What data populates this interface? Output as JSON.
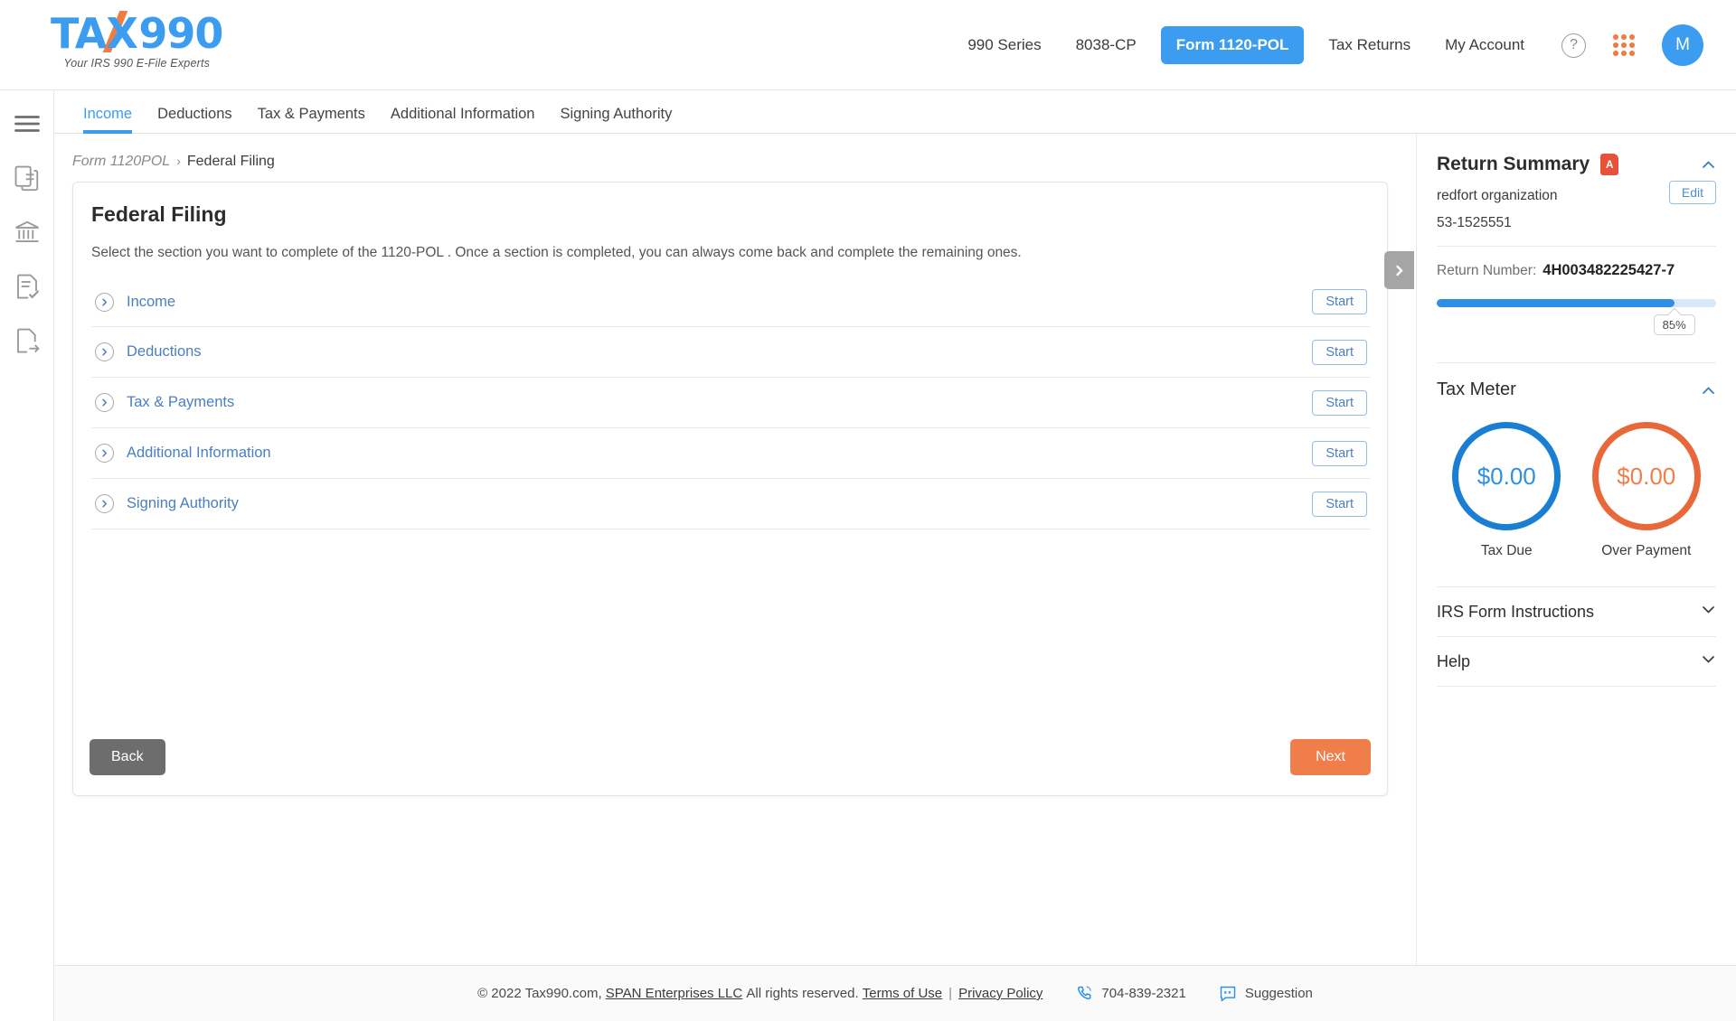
{
  "brand": {
    "logo_text": "TAX990",
    "logo_part_a": "TA",
    "logo_part_b": "990",
    "tagline": "Your IRS 990 E-File Experts",
    "accent_blue": "#3b9cf0",
    "accent_orange": "#ef7b45"
  },
  "topnav": {
    "items": [
      {
        "label": "990 Series",
        "active": false
      },
      {
        "label": "8038-CP",
        "active": false
      },
      {
        "label": "Form 1120-POL",
        "active": true
      },
      {
        "label": "Tax Returns",
        "active": false
      },
      {
        "label": "My Account",
        "active": false
      }
    ],
    "help_icon": "question-mark-icon",
    "apps_icon": "grid-apps-icon",
    "avatar_initial": "M"
  },
  "rail": {
    "items": [
      {
        "icon": "hamburger-menu-icon",
        "name": "menu-toggle"
      },
      {
        "icon": "documents-icon",
        "name": "documents"
      },
      {
        "icon": "bank-institution-icon",
        "name": "institution"
      },
      {
        "icon": "checklist-icon",
        "name": "checklist"
      },
      {
        "icon": "file-export-icon",
        "name": "export"
      }
    ]
  },
  "tabs": [
    {
      "label": "Income",
      "active": true
    },
    {
      "label": "Deductions",
      "active": false
    },
    {
      "label": "Tax & Payments",
      "active": false
    },
    {
      "label": "Additional Information",
      "active": false
    },
    {
      "label": "Signing Authority",
      "active": false
    }
  ],
  "breadcrumb": {
    "previous": "Form 1120POL",
    "separator": "›",
    "current": "Federal Filing"
  },
  "card": {
    "title": "Federal Filing",
    "description": "Select the section you want to complete of the 1120-POL . Once a section is completed, you can always come back and complete the remaining ones.",
    "sections": [
      {
        "label": "Income",
        "action": "Start"
      },
      {
        "label": "Deductions",
        "action": "Start"
      },
      {
        "label": "Tax & Payments",
        "action": "Start"
      },
      {
        "label": "Additional Information",
        "action": "Start"
      },
      {
        "label": "Signing Authority",
        "action": "Start"
      }
    ],
    "back_label": "Back",
    "next_label": "Next"
  },
  "right_panel": {
    "return_summary": {
      "title": "Return Summary",
      "pdf_icon": "pdf-file-icon",
      "organization": "redfort organization",
      "ein": "53-1525551",
      "edit_label": "Edit",
      "return_number_label": "Return Number:",
      "return_number_value": "4H003482225427-7",
      "progress_percent": 85,
      "progress_label": "85%"
    },
    "tax_meter": {
      "title": "Tax Meter",
      "meters": [
        {
          "value": "$0.00",
          "label": "Tax Due",
          "color": "#1a7fd4"
        },
        {
          "value": "$0.00",
          "label": "Over Payment",
          "color": "#e8683a"
        }
      ]
    },
    "accordions": [
      {
        "label": "IRS Form Instructions",
        "expanded": false
      },
      {
        "label": "Help",
        "expanded": false
      }
    ]
  },
  "footer": {
    "copyright": "© 2022 Tax990.com,",
    "company_link": "SPAN Enterprises LLC",
    "rights": "All rights reserved.",
    "terms_link": "Terms of Use",
    "divider": "|",
    "privacy_link": "Privacy Policy",
    "phone": "704-839-2321",
    "suggestion": "Suggestion"
  }
}
